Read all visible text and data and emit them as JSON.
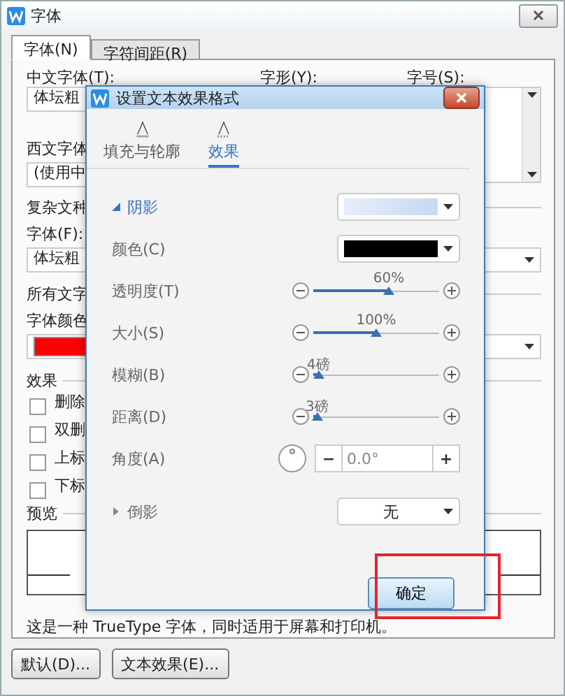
{
  "window": {
    "title": "字体"
  },
  "tabs": [
    {
      "label": "字体(N)",
      "selected": true
    },
    {
      "label": "字符间距(R)",
      "selected": false
    }
  ],
  "font": {
    "chinese_label": "中文字体(T):",
    "style_label": "字形(Y):",
    "size_label": "字号(S):",
    "chinese_value": "体坛粗",
    "western_label": "西文字体",
    "western_value": "(使用中"
  },
  "complex_script": {
    "title": "复杂文种",
    "font_label": "字体(F):",
    "font_value": "体坛粗"
  },
  "all_text": {
    "title": "所有文字",
    "color_label": "字体颜色",
    "color": "#ff0000"
  },
  "effects": {
    "title": "效果",
    "options": [
      {
        "label": "删除",
        "checked": false
      },
      {
        "label": "双删",
        "checked": false
      },
      {
        "label": "上标",
        "checked": false
      },
      {
        "label": "下标",
        "checked": false
      }
    ]
  },
  "preview": {
    "title": "预览",
    "note": "这是一种 TrueType 字体，同时适用于屏幕和打印机。"
  },
  "buttons": [
    "默认(D)...",
    "文本效果(E)..."
  ],
  "effects_dialog": {
    "title": "设置文本效果格式",
    "tabs": [
      {
        "label": "填充与轮廓",
        "selected": false
      },
      {
        "label": "效果",
        "selected": true
      }
    ],
    "shadow": {
      "title": "阴影",
      "expanded": true,
      "color_label": "颜色(C)",
      "color": "#000000",
      "sliders": [
        {
          "label": "透明度(T)",
          "reading": "60%",
          "level": 0.6
        },
        {
          "label": "大小(S)",
          "reading": "100%",
          "level": 0.5
        },
        {
          "label": "模糊(B)",
          "reading": "4磅",
          "level": 0.04
        },
        {
          "label": "距离(D)",
          "reading": "3磅",
          "level": 0.03
        }
      ],
      "angle_label": "角度(A)",
      "angle_value": "0.0°",
      "minus": "−",
      "plus": "+"
    },
    "reflection": {
      "title": "倒影",
      "expanded": false,
      "value": "无"
    },
    "ok_button": "确定"
  }
}
